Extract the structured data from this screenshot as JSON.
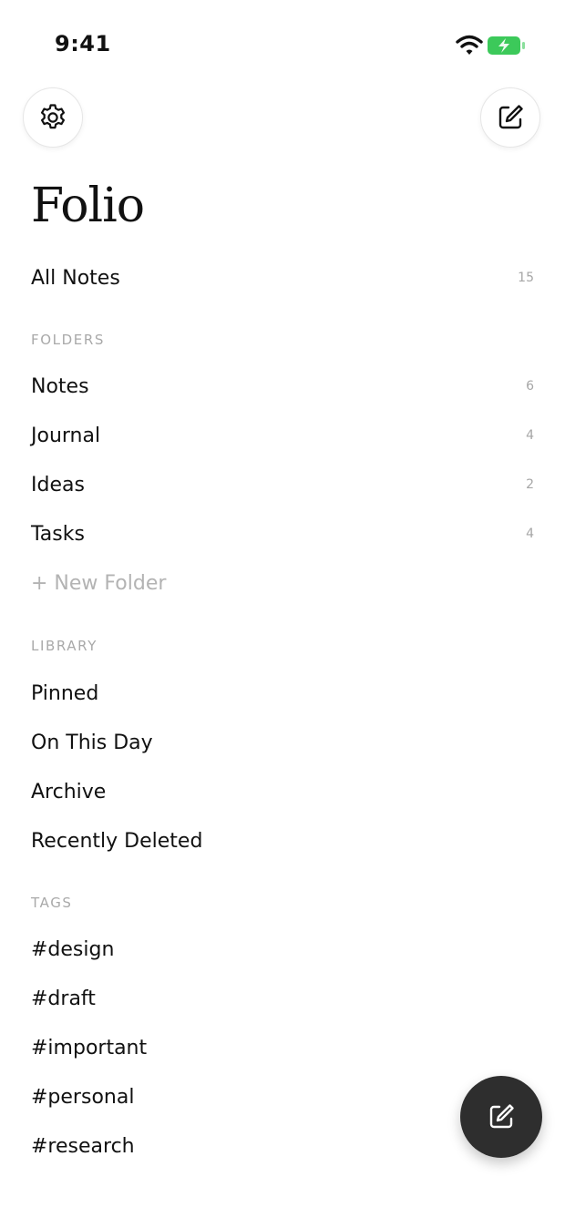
{
  "status_bar": {
    "time": "9:41",
    "battery_color": "#3cc95a"
  },
  "header": {
    "settings_icon": "gear-icon",
    "compose_icon": "compose-icon"
  },
  "app": {
    "title": "Folio"
  },
  "all_notes": {
    "label": "All Notes",
    "count": "15"
  },
  "folders": {
    "heading": "FOLDERS",
    "items": [
      {
        "label": "Notes",
        "count": "6"
      },
      {
        "label": "Journal",
        "count": "4"
      },
      {
        "label": "Ideas",
        "count": "2"
      },
      {
        "label": "Tasks",
        "count": "4"
      }
    ],
    "new_folder": "+ New Folder"
  },
  "library": {
    "heading": "LIBRARY",
    "items": [
      "Pinned",
      "On This Day",
      "Archive",
      "Recently Deleted"
    ]
  },
  "tags": {
    "heading": "TAGS",
    "items": [
      "#design",
      "#draft",
      "#important",
      "#personal",
      "#research"
    ]
  },
  "fab": {
    "icon": "compose-icon",
    "background": "#2e2e2e"
  }
}
